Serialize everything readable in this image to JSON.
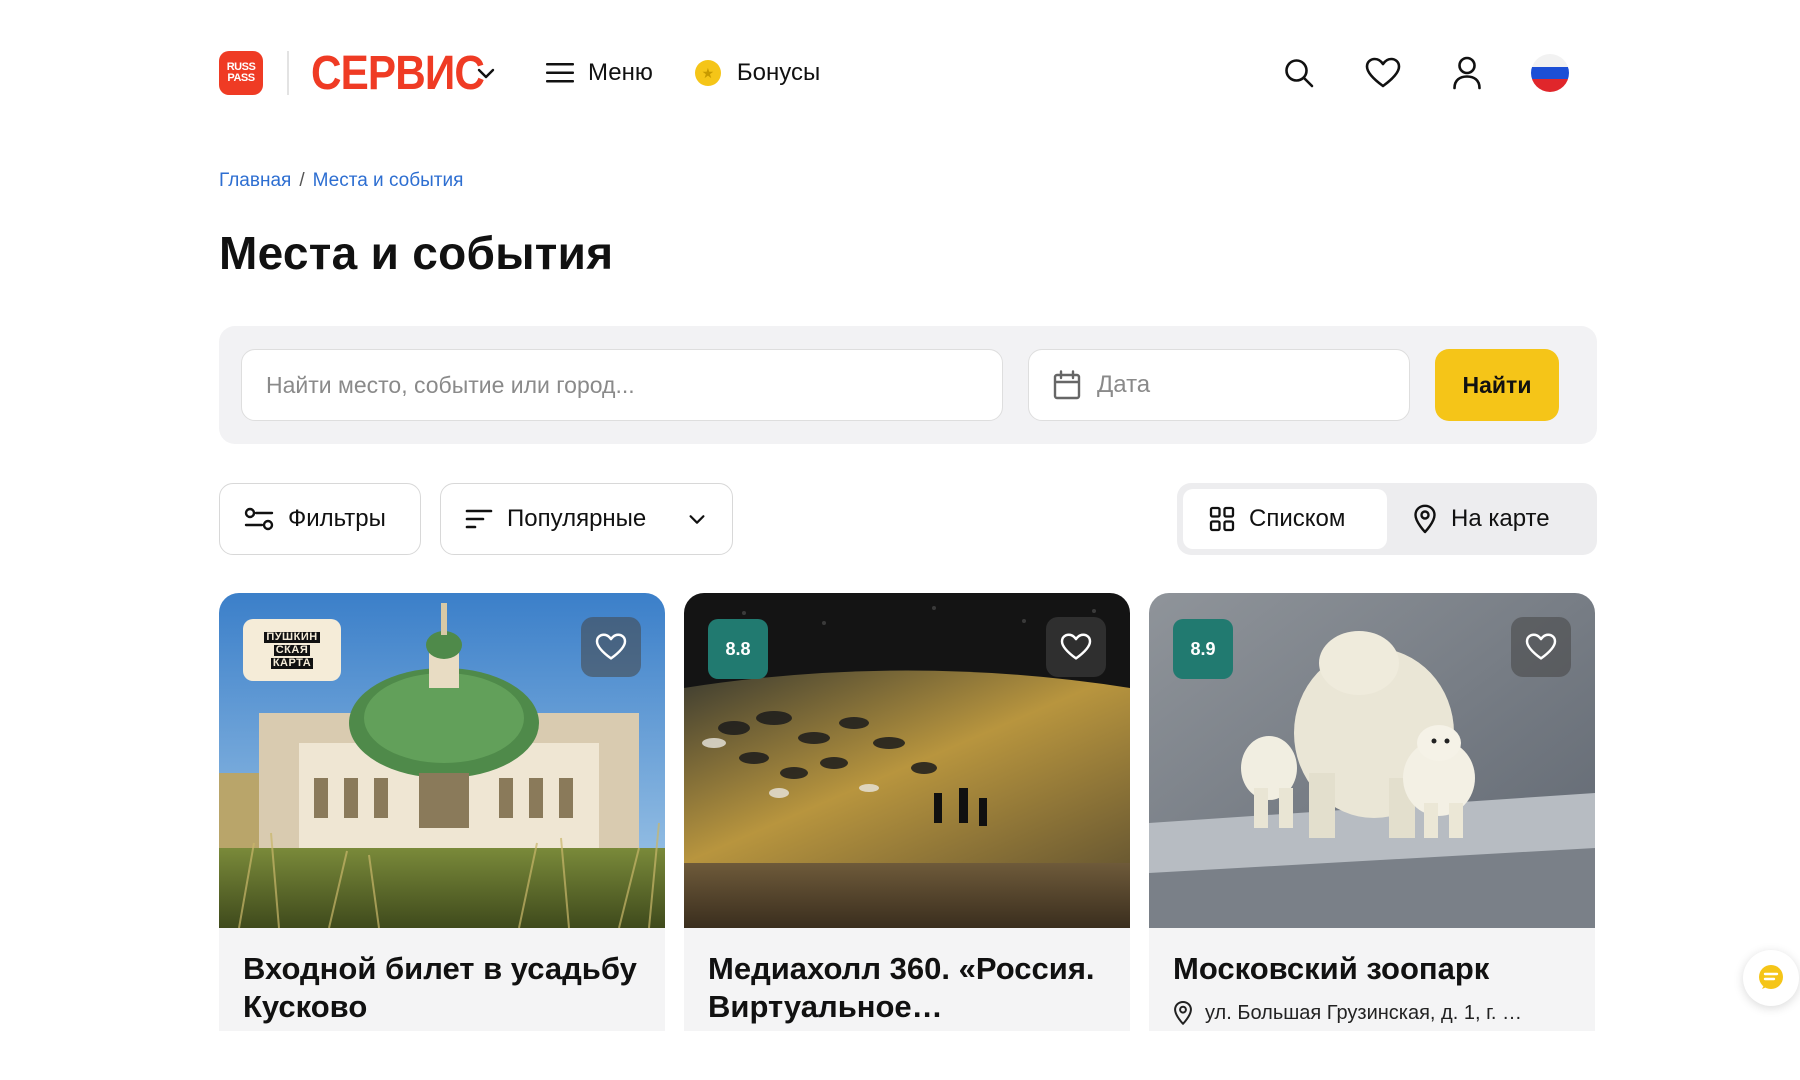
{
  "header": {
    "logo_line1": "RUSS",
    "logo_line2": "PASS",
    "brand": "СЕРВИС",
    "menu_label": "Меню",
    "bonus_label": "Бонусы"
  },
  "breadcrumb": {
    "items": [
      "Главная",
      "Места и события"
    ],
    "separator": "/"
  },
  "page_title": "Места и события",
  "search": {
    "placeholder": "Найти место, событие или город...",
    "date_placeholder": "Дата",
    "find_label": "Найти"
  },
  "filters": {
    "filters_label": "Фильтры",
    "sort_label": "Популярные",
    "view_list_label": "Списком",
    "view_map_label": "На карте",
    "active_view": "list"
  },
  "cards": [
    {
      "title": "Входной билет в усадьбу Кусково",
      "badge_lines": [
        "ПУШКИН",
        "СКАЯ",
        "КАРТА"
      ],
      "rating": null,
      "address": ""
    },
    {
      "title": "Медиахолл 360. «Россия. Виртуальное…",
      "badge_lines": [],
      "rating": "8.8",
      "address": ""
    },
    {
      "title": "Московский зоопарк",
      "badge_lines": [],
      "rating": "8.9",
      "address": "ул. Большая Грузинская, д. 1, г. …"
    }
  ],
  "colors": {
    "brand_red": "#ef3b24",
    "accent_yellow": "#f5c518",
    "link_blue": "#2d6ed1",
    "rating_green": "#217a70"
  }
}
